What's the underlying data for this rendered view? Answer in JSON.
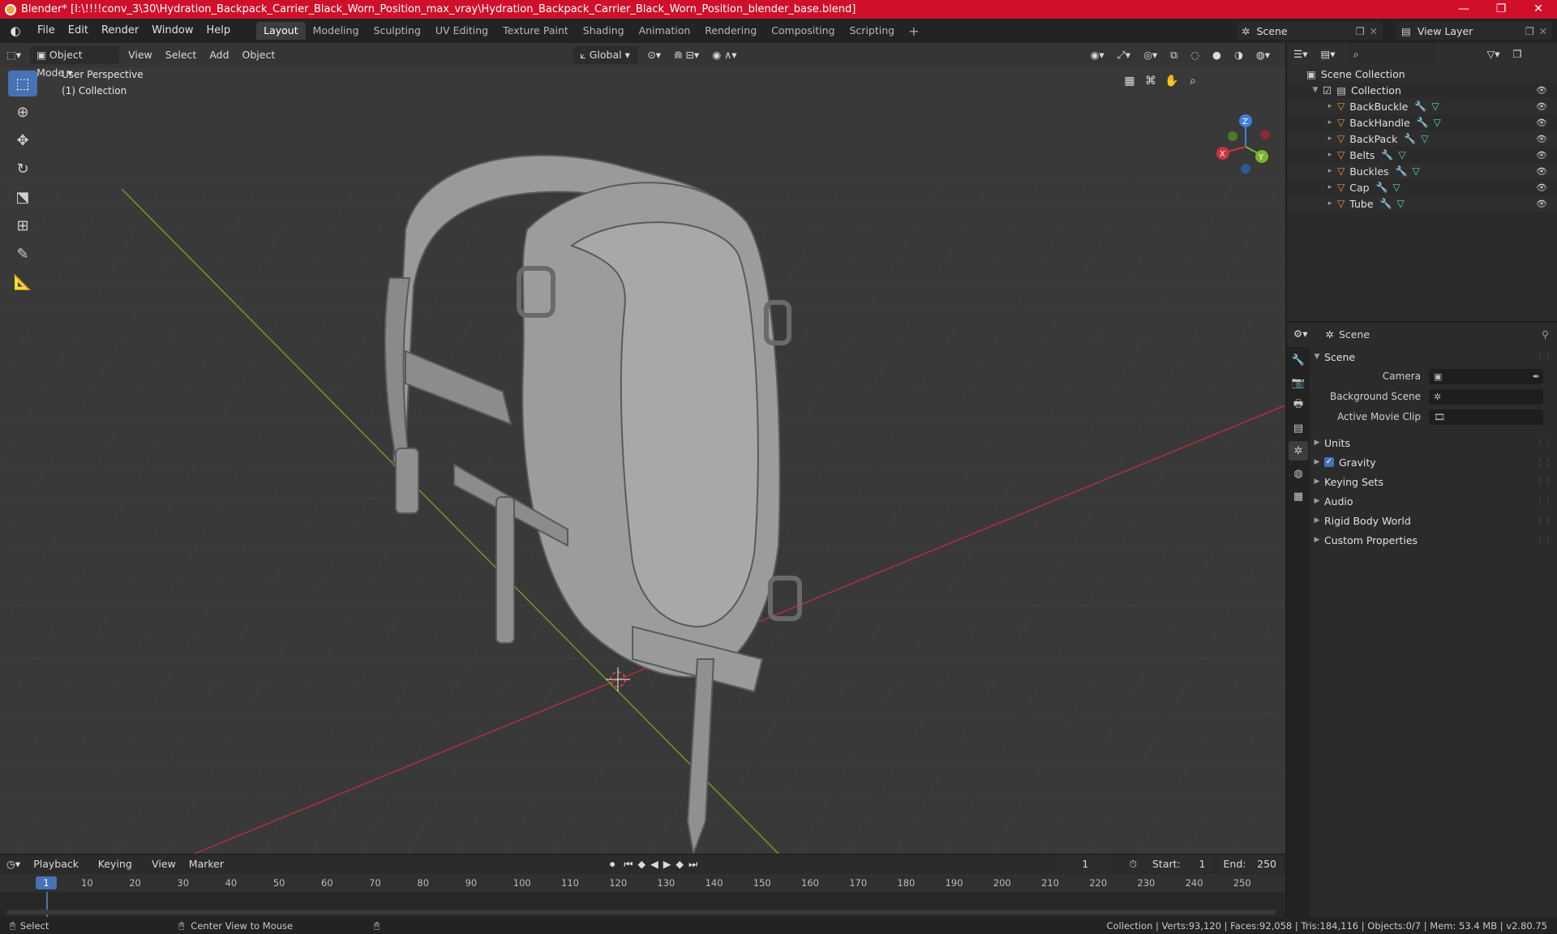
{
  "titlebar": {
    "title": "Blender* [I:\\!!!!conv_3\\30\\Hydration_Backpack_Carrier_Black_Worn_Position_max_vray\\Hydration_Backpack_Carrier_Black_Worn_Position_blender_base.blend]",
    "minimize": "—",
    "maximize": "❐",
    "close": "✕"
  },
  "menubar": {
    "items": [
      "File",
      "Edit",
      "Render",
      "Window",
      "Help"
    ],
    "workspaces": [
      "Layout",
      "Modeling",
      "Sculpting",
      "UV Editing",
      "Texture Paint",
      "Shading",
      "Animation",
      "Rendering",
      "Compositing",
      "Scripting"
    ],
    "active_workspace": "Layout",
    "add_tab": "+",
    "scene": "Scene",
    "view_layer": "View Layer"
  },
  "viewport_header": {
    "mode": "Object Mode",
    "menus": [
      "View",
      "Select",
      "Add",
      "Object"
    ],
    "orientation": "Global"
  },
  "viewport": {
    "perspective": "User Perspective",
    "collection": "(1) Collection",
    "gizmo_labels": {
      "z": "Z",
      "y": "Y",
      "x": "X"
    }
  },
  "outliner": {
    "root": "Scene Collection",
    "collection": "Collection",
    "objects": [
      "BackBuckle",
      "BackHandle",
      "BackPack",
      "Belts",
      "Buckles",
      "Cap",
      "Tube"
    ]
  },
  "properties": {
    "header": "Scene",
    "panel": "Scene",
    "fields": [
      {
        "label": "Camera",
        "value": ""
      },
      {
        "label": "Background Scene",
        "value": ""
      },
      {
        "label": "Active Movie Clip",
        "value": ""
      }
    ],
    "subpanels": [
      "Units",
      "Gravity",
      "Keying Sets",
      "Audio",
      "Rigid Body World",
      "Custom Properties"
    ]
  },
  "timeline": {
    "menus": [
      "Playback",
      "Keying",
      "View",
      "Marker"
    ],
    "current_frame": "1",
    "start_label": "Start:",
    "start": "1",
    "end_label": "End:",
    "end": "250",
    "ruler": [
      "1",
      "10",
      "20",
      "30",
      "40",
      "50",
      "60",
      "70",
      "80",
      "90",
      "100",
      "110",
      "120",
      "130",
      "140",
      "150",
      "160",
      "170",
      "180",
      "190",
      "200",
      "210",
      "220",
      "230",
      "240",
      "250"
    ]
  },
  "statusbar": {
    "select": "Select",
    "center": "Center View to Mouse",
    "stats": "Collection | Verts:93,120 | Faces:92,058 | Tris:184,116 | Objects:0/7 | Mem: 53.4 MB | v2.80.75"
  },
  "colors": {
    "title_red": "#d0102a",
    "accent_blue": "#4772b3",
    "viewport_bg": "#393939",
    "x_axis": "#c9343f",
    "y_axis": "#7bb52c",
    "z_axis": "#3e82d6"
  }
}
